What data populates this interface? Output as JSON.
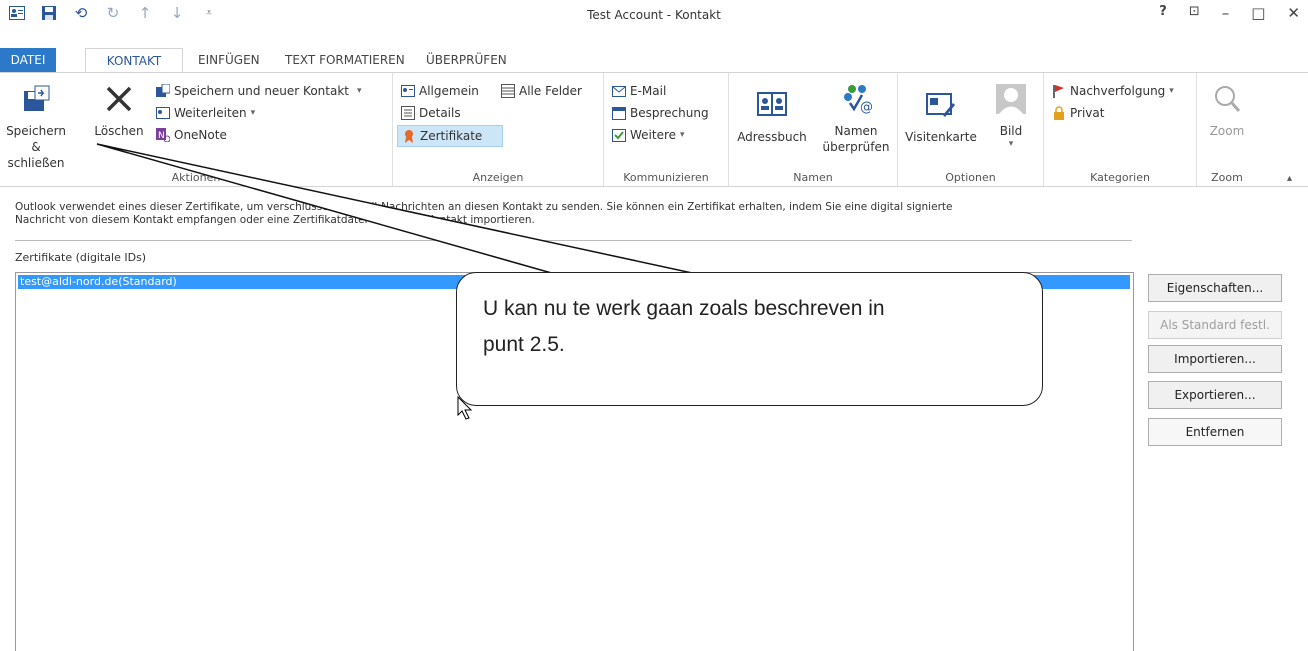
{
  "window": {
    "title": "Test Account - Kontakt",
    "controls": [
      "?",
      "⊡",
      "–",
      "□",
      "✕"
    ]
  },
  "tabs": [
    "DATEI",
    "KONTAKT",
    "EINFÜGEN",
    "TEXT FORMATIEREN",
    "ÜBERPRÜFEN"
  ],
  "ribbon": {
    "aktionen": {
      "label": "Aktionen",
      "save_close": "Speichern & schließen",
      "delete": "Löschen",
      "save_new": "Speichern und neuer Kontakt",
      "forward": "Weiterleiten",
      "onenote": "OneNote"
    },
    "anzeigen": {
      "label": "Anzeigen",
      "general": "Allgemein",
      "all_fields": "Alle Felder",
      "details": "Details",
      "certificates": "Zertifikate"
    },
    "kommunizieren": {
      "label": "Kommunizieren",
      "email": "E-Mail",
      "meeting": "Besprechung",
      "more": "Weitere"
    },
    "namen": {
      "label": "Namen",
      "address_book": "Adressbuch",
      "check_names": "Namen überprüfen"
    },
    "optionen": {
      "label": "Optionen",
      "business_card": "Visitenkarte",
      "picture": "Bild"
    },
    "kategorien": {
      "label": "Kategorien",
      "follow_up": "Nachverfolgung",
      "private": "Privat"
    },
    "zoom": {
      "label": "Zoom",
      "zoom": "Zoom"
    }
  },
  "info_text_1": "Outlook verwendet eines dieser Zertifikate, um verschlüsselte E-Mail-Nachrichten an diesen Kontakt zu senden. Sie können ein Zertifikat erhalten, indem Sie eine digital signierte",
  "info_text_2": "Nachricht von diesem Kontakt empfangen oder eine Zertifikatdatei für diesen Kontakt importieren.",
  "certificates_label": "Zertifikate (digitale IDs)",
  "certificates": [
    "test@aldi-nord.de(Standard)"
  ],
  "buttons": {
    "properties": "Eigenschaften...",
    "set_default": "Als Standard festl.",
    "import": "Importieren...",
    "export": "Exportieren...",
    "remove": "Entfernen"
  },
  "callout": {
    "line1": "U kan nu te werk gaan zoals beschreven in",
    "line2": "punt 2.5."
  }
}
